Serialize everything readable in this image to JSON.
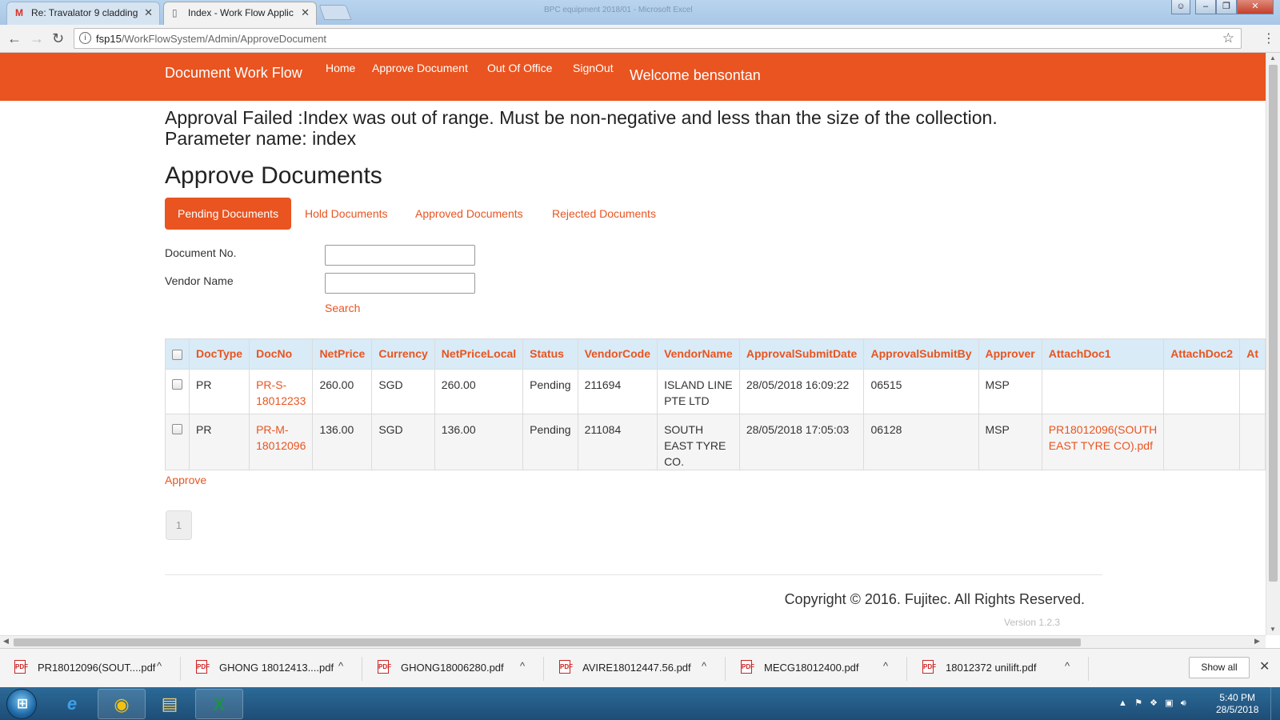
{
  "browser": {
    "tabs": [
      {
        "icon": "gmail-icon",
        "title": "Re: Travalator 9 cladding",
        "active": false
      },
      {
        "icon": "page-icon",
        "title": "Index - Work Flow Applic",
        "active": true
      }
    ],
    "background_window_title": "BPC equipment 2018/01 - Microsoft Excel",
    "url_host": "fsp15",
    "url_path": "/WorkFlowSystem/Admin/ApproveDocument"
  },
  "nav": {
    "brand": "Document Work Flow",
    "links": [
      "Home",
      "Approve Document",
      "Out Of Office",
      "SignOut"
    ],
    "welcome": "Welcome bensontan",
    "color": "#e95420"
  },
  "error_message": {
    "line1": "Approval Failed :Index was out of range. Must be non-negative and less than the size of the collection.",
    "line2": "Parameter name: index"
  },
  "page_title": "Approve Documents",
  "tabs": [
    "Pending Documents",
    "Hold Documents",
    "Approved Documents",
    "Rejected Documents"
  ],
  "filters": {
    "doc_no_label": "Document No.",
    "doc_no_value": "",
    "vendor_label": "Vendor Name",
    "vendor_value": "",
    "search_label": "Search"
  },
  "table": {
    "headers": [
      "DocType",
      "DocNo",
      "NetPrice",
      "Currency",
      "NetPriceLocal",
      "Status",
      "VendorCode",
      "VendorName",
      "ApprovalSubmitDate",
      "ApprovalSubmitBy",
      "Approver",
      "AttachDoc1",
      "AttachDoc2",
      "At"
    ],
    "rows": [
      {
        "doctype": "PR",
        "docno": "PR-S-18012233",
        "netprice": "260.00",
        "currency": "SGD",
        "netpricelocal": "260.00",
        "status": "Pending",
        "vendorcode": "211694",
        "vendorname": "ISLAND LINE PTE LTD",
        "submitdate": "28/05/2018 16:09:22",
        "submitby": "06515",
        "approver": "MSP",
        "attach1": "",
        "attach2": ""
      },
      {
        "doctype": "PR",
        "docno": "PR-M-18012096",
        "netprice": "136.00",
        "currency": "SGD",
        "netpricelocal": "136.00",
        "status": "Pending",
        "vendorcode": "211084",
        "vendorname": "SOUTH EAST TYRE CO.",
        "submitdate": "28/05/2018 17:05:03",
        "submitby": "06128",
        "approver": "MSP",
        "attach1": "PR18012096(SOUTH EAST TYRE CO).pdf",
        "attach2": ""
      }
    ]
  },
  "approve_label": "Approve",
  "pager": {
    "current": "1"
  },
  "footer": {
    "copyright": "Copyright © 2016. Fujitec. All Rights Reserved.",
    "version": "Version 1.2.3"
  },
  "downloads": {
    "items": [
      "PR18012096(SOUT....pdf",
      "GHONG 18012413....pdf",
      "GHONG18006280.pdf",
      "AVIRE18012447.56.pdf",
      "MECG18012400.pdf",
      "18012372 unilift.pdf"
    ],
    "show_all": "Show all"
  },
  "taskbar": {
    "apps": [
      "internet-explorer-icon",
      "chrome-icon",
      "file-explorer-icon",
      "excel-icon"
    ],
    "time": "5:40 PM",
    "date": "28/5/2018"
  }
}
